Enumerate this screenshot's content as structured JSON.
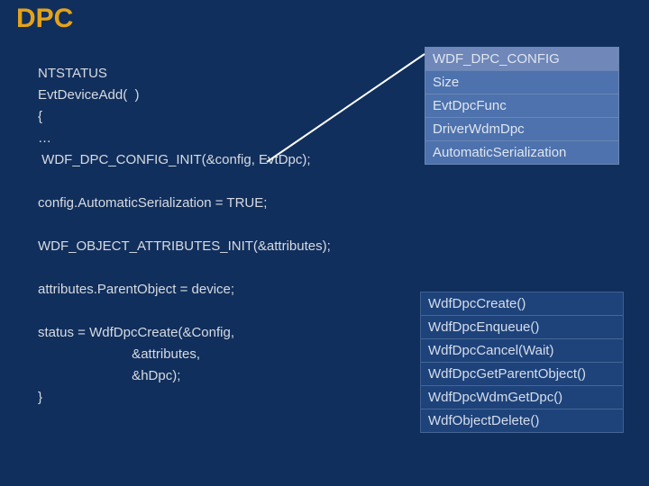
{
  "title": "DPC",
  "code_lines": [
    "NTSTATUS",
    "EvtDeviceAdd(  )",
    "{",
    "…",
    " WDF_DPC_CONFIG_INIT(&config, EvtDpc);",
    "",
    "config.AutomaticSerialization = TRUE;",
    "",
    "WDF_OBJECT_ATTRIBUTES_INIT(&attributes);",
    "",
    "attributes.ParentObject = device;",
    "",
    "status = WdfDpcCreate(&Config,",
    "                         &attributes,",
    "                         &hDpc);",
    "}"
  ],
  "struct": {
    "header": "WDF_DPC_CONFIG",
    "rows": [
      "Size",
      "EvtDpcFunc",
      "DriverWdmDpc",
      "AutomaticSerialization"
    ]
  },
  "functions": [
    "WdfDpcCreate()",
    "WdfDpcEnqueue()",
    "WdfDpcCancel(Wait)",
    "WdfDpcGetParentObject()",
    "WdfDpcWdmGetDpc()",
    "WdfObjectDelete()"
  ]
}
